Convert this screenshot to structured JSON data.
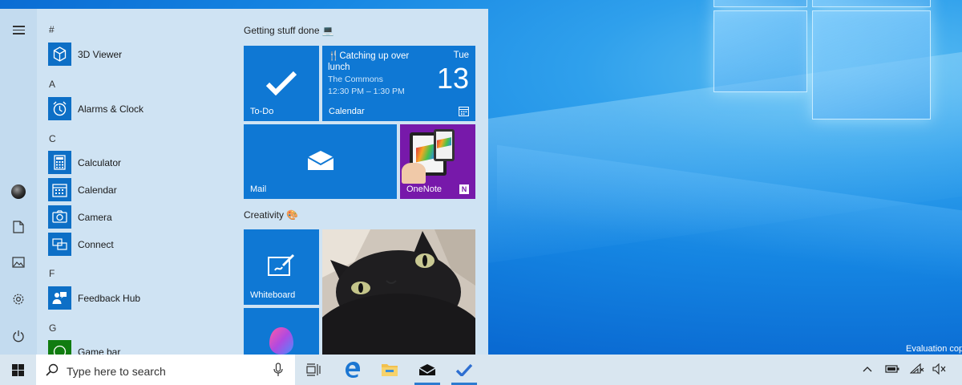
{
  "desktop": {
    "watermark": "Evaluation cop"
  },
  "start_menu": {
    "applist": {
      "sections": [
        {
          "letter": "#",
          "apps": [
            {
              "label": "3D Viewer",
              "icon": "cube-icon"
            }
          ]
        },
        {
          "letter": "A",
          "apps": [
            {
              "label": "Alarms & Clock",
              "icon": "alarm-clock-icon"
            }
          ]
        },
        {
          "letter": "C",
          "apps": [
            {
              "label": "Calculator",
              "icon": "calculator-icon"
            },
            {
              "label": "Calendar",
              "icon": "calendar-icon"
            },
            {
              "label": "Camera",
              "icon": "camera-icon"
            },
            {
              "label": "Connect",
              "icon": "connect-icon"
            }
          ]
        },
        {
          "letter": "F",
          "apps": [
            {
              "label": "Feedback Hub",
              "icon": "feedback-icon"
            }
          ]
        },
        {
          "letter": "G",
          "apps": [
            {
              "label": "Game bar",
              "icon": "xbox-icon"
            }
          ]
        }
      ]
    },
    "groups": [
      {
        "title": "Getting stuff done 💻"
      },
      {
        "title": "Creativity 🎨"
      }
    ],
    "tiles": {
      "todo": {
        "name": "To-Do"
      },
      "calendar": {
        "name": "Calendar",
        "event_title": "🍴Catching up over lunch",
        "event_location": "The Commons",
        "event_time": "12:30 PM – 1:30 PM",
        "day": "Tue",
        "date": "13"
      },
      "mail": {
        "name": "Mail"
      },
      "onenote": {
        "name": "OneNote"
      },
      "whiteboard": {
        "name": "Whiteboard"
      }
    }
  },
  "taskbar": {
    "search_placeholder": "Type here to search",
    "colors": {
      "accent": "#0f78d4",
      "taskbar": "#d9e6f0"
    }
  }
}
